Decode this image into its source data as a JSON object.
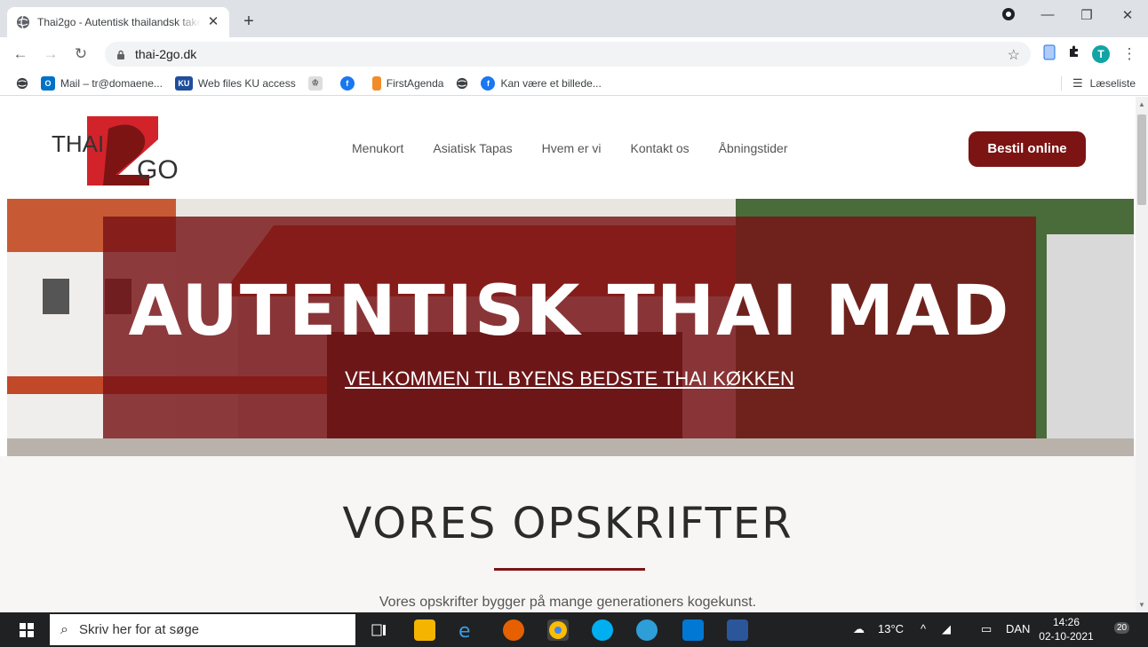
{
  "browser": {
    "tab_title": "Thai2go - Autentisk thailandsk take away",
    "tab_close": "✕",
    "new_tab": "+",
    "url": "thai-2go.dk",
    "bookmarks": [
      {
        "label": "Mail – tr@domaene...",
        "icon": "outlook-icon",
        "color": "#0072c6"
      },
      {
        "label": "Web files KU access",
        "icon": "ku-icon",
        "color": "#1f4e9c"
      },
      {
        "label": "",
        "icon": "crest-icon",
        "color": "#888888"
      },
      {
        "label": "",
        "icon": "facebook-icon",
        "color": "#1877f2"
      },
      {
        "label": "FirstAgenda",
        "icon": "firstagenda-icon",
        "color": "#f28c28"
      },
      {
        "label": "",
        "icon": "globe-icon",
        "color": "#5f6368"
      },
      {
        "label": "Kan være et billede...",
        "icon": "facebook-icon",
        "color": "#1877f2"
      }
    ],
    "reading_list": "Læseliste",
    "profile_initial": "T"
  },
  "site": {
    "logo_text_thai": "THAI",
    "logo_text_go": "GO",
    "nav": [
      "Menukort",
      "Asiatisk Tapas",
      "Hvem er vi",
      "Kontakt os",
      "Åbningstider"
    ],
    "order_button": "Bestil online",
    "hero_title": "AUTENTISK THAI MAD",
    "hero_subtitle": "VELKOMMEN TIL BYENS BEDSTE THAI KØKKEN",
    "recipes_title": "VORES OPSKRIFTER",
    "recipes_text": "Vores opskrifter bygger på mange generationers kogekunst."
  },
  "taskbar": {
    "search_placeholder": "Skriv her for at søge",
    "weather": "13°C",
    "language": "DAN",
    "time": "14:26",
    "date": "02-10-2021",
    "notifications": "20"
  },
  "colors": {
    "brand_red": "#7c1414",
    "hero_overlay": "#781216"
  }
}
